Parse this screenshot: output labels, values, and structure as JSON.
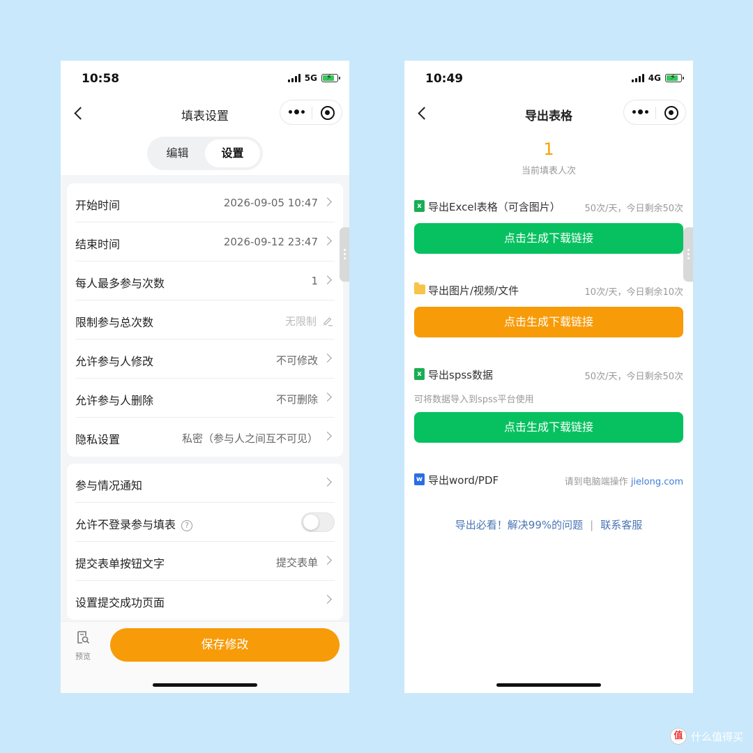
{
  "left": {
    "status": {
      "time": "10:58",
      "network": "5G"
    },
    "nav": {
      "title": "填表设置"
    },
    "segment": {
      "edit": "编辑",
      "settings": "设置"
    },
    "settings_card1": [
      {
        "label": "开始时间",
        "value": "2026-09-05 10:47"
      },
      {
        "label": "结束时间",
        "value": "2026-09-12 23:47"
      },
      {
        "label": "每人最多参与次数",
        "value": "1"
      },
      {
        "label": "限制参与总次数",
        "value": "无限制"
      },
      {
        "label": "允许参与人修改",
        "value": "不可修改"
      },
      {
        "label": "允许参与人删除",
        "value": "不可删除"
      },
      {
        "label": "隐私设置",
        "value": "私密（参与人之间互不可见）"
      }
    ],
    "settings_card2": [
      {
        "label": "参与情况通知",
        "value": ""
      },
      {
        "label": "允许不登录参与填表",
        "value": "",
        "help": "?",
        "toggle_on": false
      },
      {
        "label": "提交表单按钮文字",
        "value": "提交表单"
      },
      {
        "label": "设置提交成功页面",
        "value": ""
      }
    ],
    "bottom": {
      "preview_label": "预览",
      "save_label": "保存修改"
    }
  },
  "right": {
    "status": {
      "time": "10:49",
      "network": "4G"
    },
    "nav": {
      "title": "导出表格"
    },
    "count": {
      "value": "1",
      "label": "当前填表人次"
    },
    "exports": [
      {
        "icon": "excel-file-icon",
        "icon_text": "x",
        "title": "导出Excel表格（可含图片）",
        "quota": "50次/天，今日剩余50次",
        "button": "点击生成下载链接",
        "button_color": "#07c160"
      },
      {
        "icon": "folder-icon",
        "title": "导出图片/视频/文件",
        "quota": "10次/天，今日剩余10次",
        "button": "点击生成下载链接",
        "button_color": "#f79b09"
      },
      {
        "icon": "excel-file-icon",
        "icon_text": "x",
        "title": "导出spss数据",
        "quota": "50次/天，今日剩余50次",
        "subtext": "可将数据导入到spss平台使用",
        "button": "点击生成下载链接",
        "button_color": "#07c160"
      },
      {
        "icon": "word-file-icon",
        "icon_text": "w",
        "title": "导出word/PDF",
        "quota_prefix": "请到电脑端操作",
        "quota_link": "jielong.com"
      }
    ],
    "help": {
      "faq": "导出必看！解决99%的问题",
      "separator": "|",
      "contact": "联系客服"
    }
  },
  "watermark": {
    "logo": "值",
    "text": "什么值得买"
  },
  "colors": {
    "background": "#c9e8fb",
    "orange": "#f79b09",
    "green": "#07c160",
    "accent_count": "#f5a200",
    "link": "#4a74b4"
  }
}
